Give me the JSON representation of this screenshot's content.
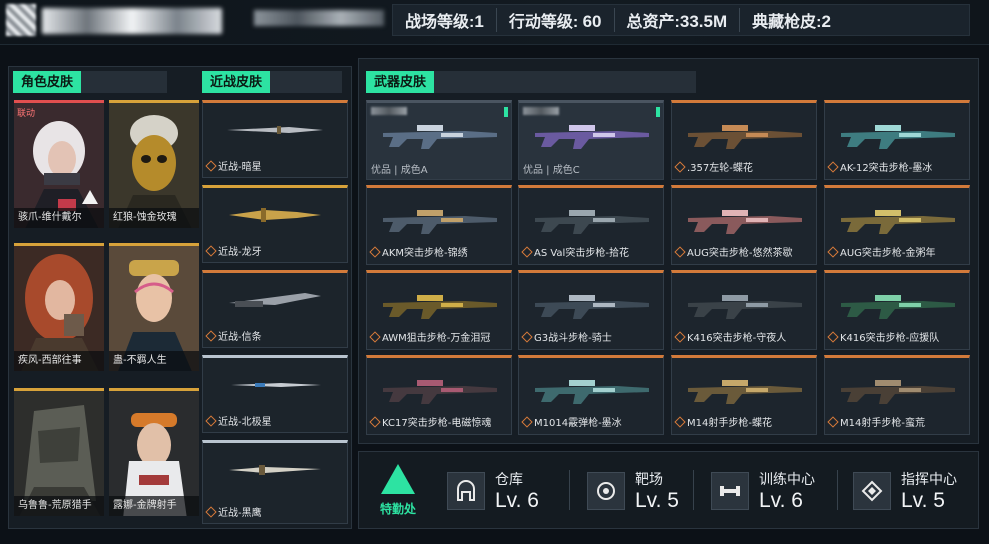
{
  "header": {
    "stats": [
      {
        "label": "战场等级:",
        "value": "1"
      },
      {
        "label": "行动等级: ",
        "value": "60"
      },
      {
        "label": "总资产:",
        "value": "33.5M"
      },
      {
        "label": "典藏枪皮:",
        "value": "2"
      }
    ]
  },
  "sections": {
    "character_title": "角色皮肤",
    "melee_title": "近战皮肤",
    "weapon_title": "武器皮肤"
  },
  "characters": [
    {
      "label": "骇爪-维什戴尔",
      "badge": "联动"
    },
    {
      "label": "红狼-蚀金玫瑰"
    },
    {
      "label": "疾风-西部往事"
    },
    {
      "label": "蛊-不羁人生"
    },
    {
      "label": "乌鲁鲁-荒原猎手"
    },
    {
      "label": "露娜-金牌射手"
    }
  ],
  "melee": [
    {
      "label": "近战-暗星"
    },
    {
      "label": "近战-龙牙"
    },
    {
      "label": "近战-信条"
    },
    {
      "label": "近战-北极星"
    },
    {
      "label": "近战-黑鹰"
    }
  ],
  "weapons": [
    {
      "label": "优品 | 成色A",
      "kind": "quality"
    },
    {
      "label": "优品 | 成色C",
      "kind": "quality"
    },
    {
      "label": ".357左轮-蝶花"
    },
    {
      "label": "AK-12突击步枪-墨冰"
    },
    {
      "label": "AKM突击步枪-锦绣"
    },
    {
      "label": "AS Val突击步枪-拾花"
    },
    {
      "label": "AUG突击步枪-悠然茶歇"
    },
    {
      "label": "AUG突击步枪-金粥年"
    },
    {
      "label": "AWM狙击步枪-万金泪冠"
    },
    {
      "label": "G3战斗步枪-骑士"
    },
    {
      "label": "K416突击步枪-守夜人"
    },
    {
      "label": "K416突击步枪-应援队"
    },
    {
      "label": "KC17突击步枪-电磁惊魂"
    },
    {
      "label": "M1014霰弹枪-墨冰"
    },
    {
      "label": "M14射手步枪-蝶花"
    },
    {
      "label": "M14射手步枪-蛮荒"
    }
  ],
  "bottom": {
    "logo_text": "特勤处",
    "facilities": [
      {
        "name": "仓库",
        "level": "Lv. 6",
        "icon": "warehouse-icon"
      },
      {
        "name": "靶场",
        "level": "Lv. 5",
        "icon": "target-icon"
      },
      {
        "name": "训练中心",
        "level": "Lv. 6",
        "icon": "dumbbell-icon"
      },
      {
        "name": "指挥中心",
        "level": "Lv. 5",
        "icon": "command-icon"
      }
    ]
  },
  "colors": {
    "accent": "#2de3a2",
    "rarity_red": "#e14f4f",
    "rarity_orange": "#d27a3a",
    "rarity_gold": "#d7a23a"
  }
}
